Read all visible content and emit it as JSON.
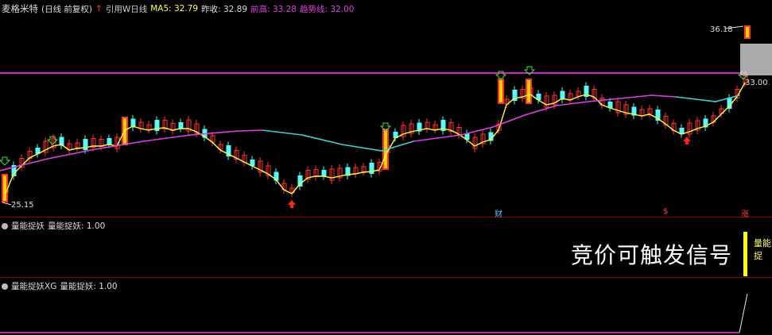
{
  "main_header": {
    "title": "麦格米特",
    "mode": "(日线 前复权)",
    "up_arrow": "↑",
    "ref_label": "引用W日线",
    "ma5_label": "MA5: 32.79",
    "prev_close_label": "昨收: 32.89",
    "prev_high_label": "前高: 33.28",
    "trend_label": "趋势线: 32.00"
  },
  "price_labels": {
    "high": "36.18",
    "low": "25.15",
    "level": "33.00"
  },
  "markers": {
    "cai": "财",
    "dollar": "$",
    "zhang": "涨"
  },
  "indicator1": {
    "name": "量能捉妖",
    "value_label": "量能捉妖: 1.00",
    "caption": "竞价可触发信号",
    "right_tag": "量能捉"
  },
  "indicator2": {
    "name": "量能捉妖XG",
    "value_label": "量能捉妖: 1.00"
  },
  "colors": {
    "up": "#ff3232",
    "down": "#54fcfc",
    "ma5": "#ffff44",
    "trend_pink": "#e040e0",
    "trend_cyan": "#40d0d0",
    "prev_high_line": "#d020d0",
    "frame": "#8a0000"
  },
  "icons": [
    "down-arrow-icon",
    "up-arrow-icon",
    "header-up-arrow-icon",
    "indicator-dot-icon"
  ]
}
